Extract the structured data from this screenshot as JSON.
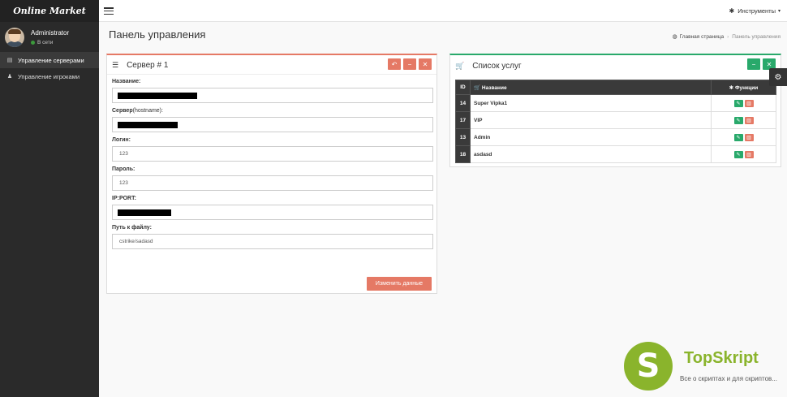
{
  "app": {
    "brand": "Online Market"
  },
  "user": {
    "name": "Administrator",
    "status": "В сети"
  },
  "sidebar": {
    "items": [
      {
        "label": "Управление серверами",
        "icon": "server-icon",
        "active": true
      },
      {
        "label": "Управление игроками",
        "icon": "user-icon",
        "active": false
      }
    ]
  },
  "topbar": {
    "tools_label": "Инструменты"
  },
  "page": {
    "title": "Панель управления"
  },
  "breadcrumb": {
    "home": "Главная страница",
    "current": "Панель управления"
  },
  "server_box": {
    "title": "Сервер # 1",
    "fields": {
      "name": {
        "label": "Название:",
        "value": ""
      },
      "host": {
        "label": "Сервер",
        "label_sub": "(hostname):",
        "value": ""
      },
      "login": {
        "label": "Логин:",
        "value": "123"
      },
      "password": {
        "label": "Пароль:",
        "value": "123"
      },
      "ipport": {
        "label": "IP:PORT:",
        "value": ""
      },
      "path": {
        "label": "Путь к файлу:",
        "value": "cstrike/sadasd"
      }
    },
    "submit_label": "Изменить данные"
  },
  "services_box": {
    "title": "Список услуг",
    "columns": {
      "id": "ID",
      "name": "Название",
      "functions": "Функции"
    },
    "rows": [
      {
        "id": "14",
        "name": "Super Vipka1"
      },
      {
        "id": "17",
        "name": "VIP"
      },
      {
        "id": "13",
        "name": "Admin"
      },
      {
        "id": "18",
        "name": "asdasd"
      }
    ]
  },
  "colors": {
    "accent_red": "#e57965",
    "accent_green": "#29a96b",
    "sidebar_bg": "#2a2a2a"
  },
  "watermark": {
    "title": "TopSkript",
    "subtitle": "Все о скриптах и для скриптов...",
    "letter": "S"
  }
}
